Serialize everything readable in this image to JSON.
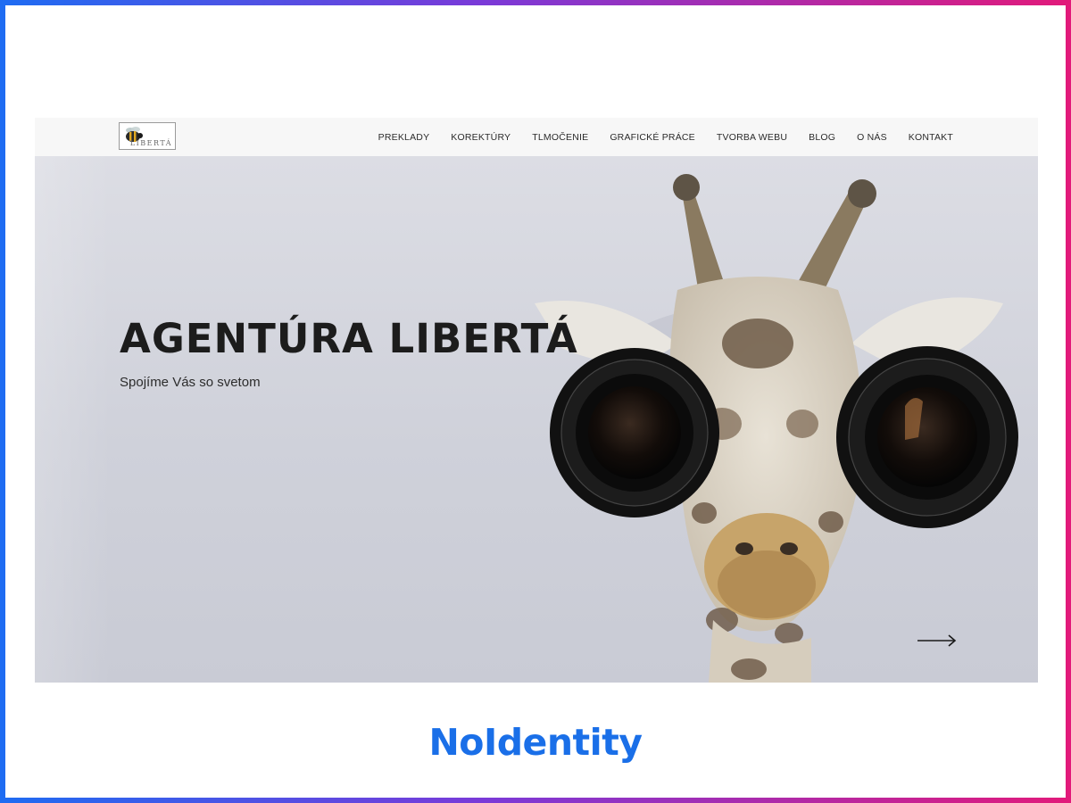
{
  "site": {
    "logo": {
      "text": "LIBERTÁ",
      "icon": "bee-icon"
    },
    "nav": [
      {
        "label": "PREKLADY"
      },
      {
        "label": "KOREKTÚRY"
      },
      {
        "label": "TLMOČENIE"
      },
      {
        "label": "GRAFICKÉ PRÁCE"
      },
      {
        "label": "TVORBA WEBU"
      },
      {
        "label": "BLOG"
      },
      {
        "label": "O NÁS"
      },
      {
        "label": "KONTAKT"
      }
    ],
    "hero": {
      "title": "AGENTÚRA LIBERTÁ",
      "subtitle": "Spojíme Vás so svetom",
      "next_icon": "arrow-right-icon"
    }
  },
  "brand": {
    "label": "NoIdentity"
  },
  "colors": {
    "frame_start": "#1e6cf2",
    "frame_end": "#e21a7a",
    "brand": "#1a6fe8"
  }
}
